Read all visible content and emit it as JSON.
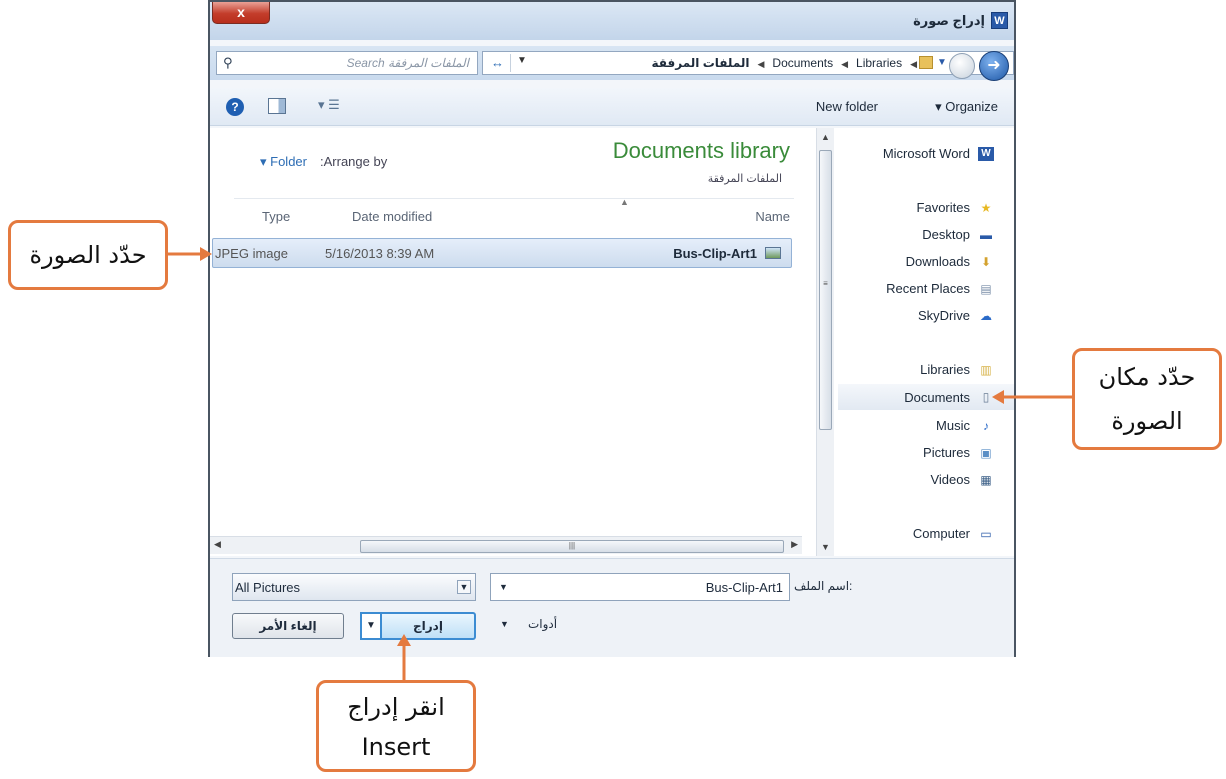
{
  "window": {
    "title": "إدراج صورة",
    "app_icon": "W",
    "close_label": "x"
  },
  "address": {
    "search_placeholder": "Search الملفات المرفقة",
    "crumbs": [
      "الملفات المرفقة",
      "Documents",
      "Libraries"
    ]
  },
  "toolbar": {
    "new_folder": "New folder",
    "organize": "Organize"
  },
  "library": {
    "title": "Documents library",
    "subtitle": "الملفات المرفقة",
    "arrange_by": ":Arrange by",
    "arrange_value": "Folder"
  },
  "columns": {
    "type": "Type",
    "date": "Date modified",
    "name": "Name"
  },
  "files": [
    {
      "type": "JPEG image",
      "date": "5/16/2013 8:39 AM",
      "name": "Bus-Clip-Art1"
    }
  ],
  "nav": {
    "items": [
      {
        "label": "Microsoft Word",
        "icon": "word-icon",
        "glyph": "W"
      },
      {
        "label": "Favorites",
        "icon": "star-icon",
        "glyph": "★"
      },
      {
        "label": "Desktop",
        "icon": "desktop-icon",
        "glyph": "▬"
      },
      {
        "label": "Downloads",
        "icon": "downloads-icon",
        "glyph": "⬇"
      },
      {
        "label": "Recent Places",
        "icon": "recent-places-icon",
        "glyph": "▤"
      },
      {
        "label": "SkyDrive",
        "icon": "cloud-icon",
        "glyph": "☁"
      },
      {
        "label": "Libraries",
        "icon": "libraries-icon",
        "glyph": "▥"
      },
      {
        "label": "Documents",
        "icon": "document-icon",
        "glyph": "▯"
      },
      {
        "label": "Music",
        "icon": "music-icon",
        "glyph": "♪"
      },
      {
        "label": "Pictures",
        "icon": "pictures-icon",
        "glyph": "▣"
      },
      {
        "label": "Videos",
        "icon": "videos-icon",
        "glyph": "▦"
      },
      {
        "label": "Computer",
        "icon": "computer-icon",
        "glyph": "▭"
      }
    ],
    "selected": "Documents"
  },
  "bottom": {
    "filetype": "All Pictures",
    "filename_label": "اسم الملف:",
    "filename_value": "Bus-Clip-Art1",
    "tools_label": "أدوات",
    "insert_label": "إدراج",
    "cancel_label": "إلغاء الأمر"
  },
  "callouts": {
    "select_image": "حدّد الصورة",
    "select_location_line1": "حدّد مكان",
    "select_location_line2": "الصورة",
    "click_insert_line1": "انقر إدراج",
    "click_insert_line2": "Insert"
  },
  "colors": {
    "callout_border": "#e47a3f",
    "library_title": "#3a8b3a",
    "selection_row": "#cddcee",
    "insert_border": "#3c8cd2"
  }
}
